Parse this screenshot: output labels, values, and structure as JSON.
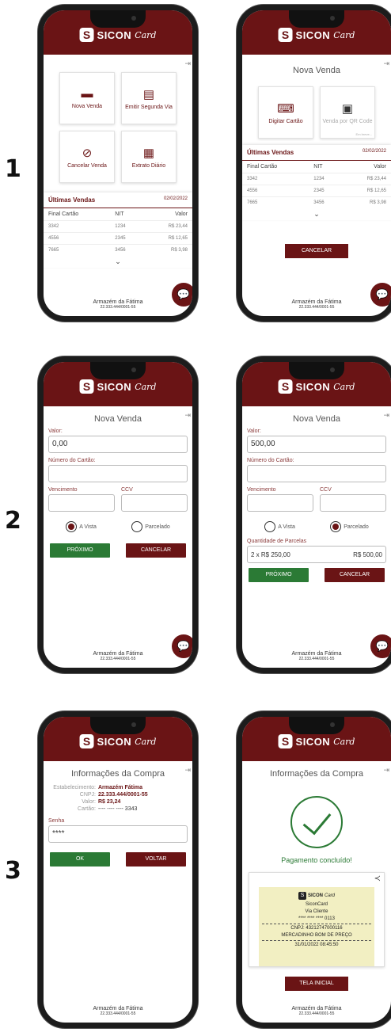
{
  "steps": [
    "1",
    "2",
    "3"
  ],
  "brand": {
    "mark": "S",
    "name": "SICON",
    "script": "Card"
  },
  "footer": {
    "store": "Armazém da Fátima",
    "cnpj": "22.333.444/0001-55"
  },
  "colors": {
    "brand": "#6a1415",
    "success": "#2b7a35"
  },
  "icons": {
    "exit": "exit-icon",
    "chat": "chat-icon",
    "chevron": "chevron-down-icon"
  },
  "menu": {
    "nova_venda": "Nova Venda",
    "emitir": "Emitir Segunda Via",
    "cancelar": "Cancelar Venda",
    "extrato": "Extrato Diário"
  },
  "sales": {
    "title": "Últimas Vendas",
    "date": "02/02/2022",
    "columns": [
      "Final Cartão",
      "NIT",
      "Valor"
    ],
    "rows": [
      [
        "3342",
        "1234",
        "R$ 23,44"
      ],
      [
        "4556",
        "2345",
        "R$ 12,65"
      ],
      [
        "7665",
        "3456",
        "R$ 3,98"
      ]
    ]
  },
  "nova_venda": {
    "title": "Nova Venda",
    "digitar": "Digitar Cartão",
    "qr": "Venda por QR Code",
    "soon": "Em breve...",
    "cancel": "CANCELAR"
  },
  "form": {
    "valor_label": "Valor:",
    "numero_label": "Número do Cartão:",
    "venc_label": "Vencimento",
    "ccv_label": "CCV",
    "avista": "A Vista",
    "parcelado": "Parcelado",
    "next": "PRÓXIMO",
    "cancel": "CANCELAR",
    "valor_a": "0,00",
    "valor_b": "500,00",
    "parcelas_label": "Quantidade de Parcelas",
    "parcelas_opt": "2 x  R$ 250,00",
    "parcelas_total": "R$ 500,00"
  },
  "confirm": {
    "title": "Informações da Compra",
    "estab_k": "Estabelecimento:",
    "estab_v": "Armazém Fátima",
    "cnpj_k": "CNPJ:",
    "cnpj_v": "22.333.444/0001-55",
    "valor_k": "Valor:",
    "valor_v": "R$ 23,24",
    "cartao_k": "Cartão:",
    "cartao_v": "---- ---- ---- 3343",
    "senha_label": "Senha",
    "senha_v": "****",
    "ok": "OK",
    "back": "VOLTAR"
  },
  "success": {
    "title": "Informações da Compra",
    "msg": "Pagamento concluído!",
    "r1": "SiconCard",
    "r2": "Via Cliente",
    "r3": "**** **** **** 0113",
    "r4": "CNPJ: 43212747000116",
    "r5": "MERCADINHO BOM DE PREÇO",
    "r6": "31/01/2022 08:45:50",
    "home": "TELA INICIAL"
  }
}
